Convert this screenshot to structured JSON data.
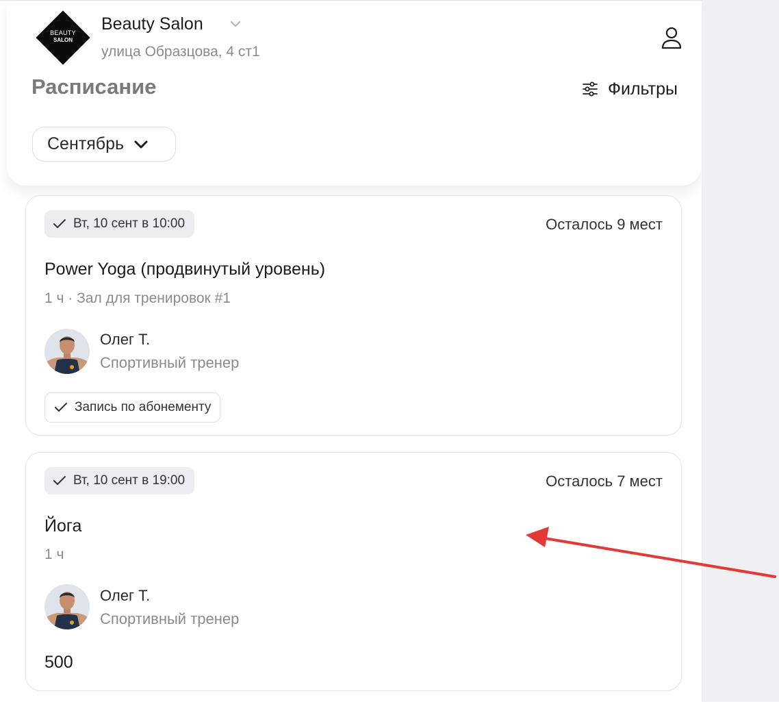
{
  "header": {
    "logo_line1": "BEAUTY",
    "logo_line2": "SALON",
    "salon_name": "Beauty Salon",
    "address": "улица Образцова, 4 ст1",
    "icons": {
      "dropdown": "chevron-down-icon",
      "profile": "user-icon"
    }
  },
  "schedule": {
    "title": "Расписание",
    "filters_label": "Фильтры",
    "filters_icon": "sliders-icon",
    "month_selected": "Сентябрь"
  },
  "events": [
    {
      "date": "Вт, 10 сент в 10:00",
      "seats": "Осталось 9 мест",
      "title": "Power Yoga (продвинутый уровень)",
      "meta": "1 ч · Зал для тренировок #1",
      "trainer_name": "Олег Т.",
      "trainer_role": "Спортивный тренер",
      "badge": "Запись по абонементу"
    },
    {
      "date": "Вт, 10 сент в 19:00",
      "seats": "Осталось 7 мест",
      "title": "Йога",
      "meta": "1 ч",
      "trainer_name": "Олег Т.",
      "trainer_role": "Спортивный тренер",
      "price": "500"
    }
  ],
  "colors": {
    "accent_annotation": "#e53935",
    "chip_bg": "#ececf1",
    "muted_text": "#8a8a8f"
  }
}
